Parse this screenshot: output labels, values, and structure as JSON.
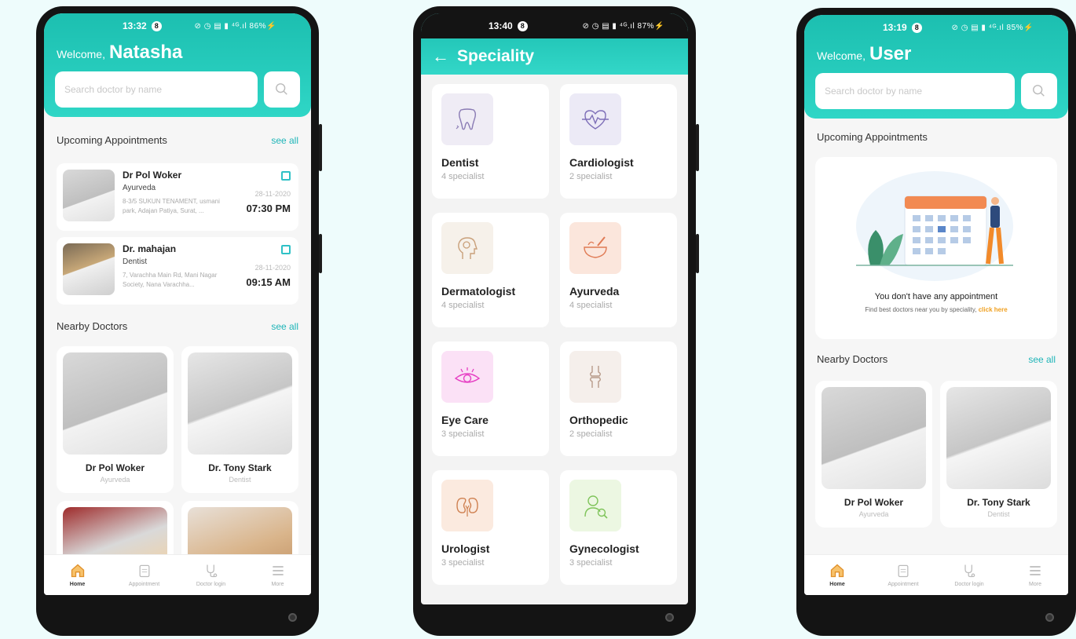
{
  "phone1": {
    "status": {
      "time": "13:32",
      "badge": "8",
      "icons": "⊘ ◷ ▤ ▮ ⁴ᴳ.ıl 86%⚡"
    },
    "welcome": "Welcome,",
    "user_name": "Natasha",
    "search_placeholder": "Search doctor by name",
    "upcoming_title": "Upcoming Appointments",
    "see_all": "see all",
    "appointments": [
      {
        "name": "Dr Pol Woker",
        "speciality": "Ayurveda",
        "address": "8-3/5 SUKUN TENAMENT, usmani park, Adajan Patiya, Surat, ...",
        "date": "28-11-2020",
        "time": "07:30 PM"
      },
      {
        "name": "Dr. mahajan",
        "speciality": "Dentist",
        "address": "7, Varachha Main Rd, Mani Nagar Society, Nana Varachha...",
        "date": "28-11-2020",
        "time": "09:15 AM"
      }
    ],
    "nearby_title": "Nearby Doctors",
    "nearby_see_all": "see all",
    "doctors": [
      {
        "name": "Dr Pol Woker",
        "speciality": "Ayurveda"
      },
      {
        "name": "Dr. Tony Stark",
        "speciality": "Dentist"
      }
    ]
  },
  "phone2": {
    "status": {
      "time": "13:40",
      "badge": "8",
      "icons": "⊘ ◷ ▤ ▮ ⁴ᴳ.ıl 87%⚡"
    },
    "title": "Speciality",
    "specialities": [
      {
        "name": "Dentist",
        "count": "4 specialist",
        "icon": "tooth-icon",
        "bg": "#efecf5",
        "color": "#8a7bb4"
      },
      {
        "name": "Cardiologist",
        "count": "2 specialist",
        "icon": "heart-icon",
        "bg": "#eceaf6",
        "color": "#7e6fb8"
      },
      {
        "name": "Dermatologist",
        "count": "4 specialist",
        "icon": "head-icon",
        "bg": "#f6f1ea",
        "color": "#c9a07a"
      },
      {
        "name": "Ayurveda",
        "count": "4 specialist",
        "icon": "mortar-icon",
        "bg": "#fbe6dc",
        "color": "#e07b55"
      },
      {
        "name": "Eye Care",
        "count": "3 specialist",
        "icon": "eye-icon",
        "bg": "#fbe1f6",
        "color": "#e63ec3"
      },
      {
        "name": "Orthopedic",
        "count": "2 specialist",
        "icon": "bone-icon",
        "bg": "#f5efeb",
        "color": "#b89b8a"
      },
      {
        "name": "Urologist",
        "count": "3 specialist",
        "icon": "kidney-icon",
        "bg": "#fbeadf",
        "color": "#cf8050"
      },
      {
        "name": "Gynecologist",
        "count": "3 specialist",
        "icon": "woman-icon",
        "bg": "#ecf7e2",
        "color": "#7fc45a"
      }
    ]
  },
  "phone3": {
    "status": {
      "time": "13:19",
      "badge": "8",
      "icons": "⊘ ◷ ▤ ▮ ⁴ᴳ.ıl 85%⚡"
    },
    "welcome": "Welcome,",
    "user_name": "User",
    "search_placeholder": "Search doctor by name",
    "upcoming_title": "Upcoming Appointments",
    "empty_title": "You don't have any appointment",
    "empty_sub": "Find best doctors near you by speciality,",
    "empty_link": "click here",
    "nearby_title": "Nearby Doctors",
    "nearby_see_all": "see all",
    "doctors": [
      {
        "name": "Dr Pol Woker",
        "speciality": "Ayurveda"
      },
      {
        "name": "Dr. Tony Stark",
        "speciality": "Dentist"
      }
    ]
  },
  "nav": [
    {
      "label": "Home",
      "icon": "home-icon"
    },
    {
      "label": "Appointment",
      "icon": "clipboard-icon"
    },
    {
      "label": "Doctor login",
      "icon": "stethoscope-icon"
    },
    {
      "label": "More",
      "icon": "menu-icon"
    }
  ],
  "colors": {
    "accent": "#1fb5b8",
    "teal": "#22c7b8",
    "link": "#f0a020",
    "nav_active": "#f09a2a"
  }
}
